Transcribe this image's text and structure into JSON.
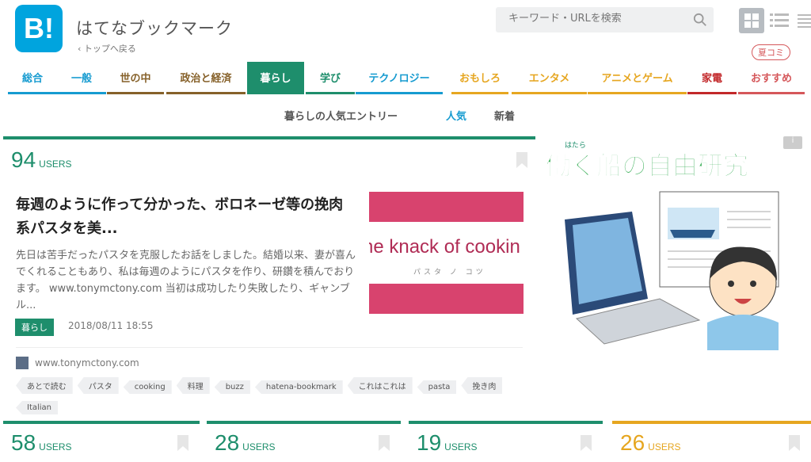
{
  "header": {
    "logo_text": "B!",
    "site_title": "はてなブックマーク",
    "back_link": "‹ トップへ戻る",
    "search_placeholder": "キーワード・URLを検索",
    "natsu_badge": "夏コミ"
  },
  "nav": {
    "items": [
      {
        "label": "総合",
        "color": "#169bd0"
      },
      {
        "label": "一般",
        "color": "#169bd0"
      },
      {
        "label": "世の中",
        "color": "#86612a"
      },
      {
        "label": "政治と経済",
        "color": "#86612a"
      },
      {
        "label": "暮らし",
        "color": "#1e8e6c",
        "active": true
      },
      {
        "label": "学び",
        "color": "#1e8e6c"
      },
      {
        "label": "テクノロジー",
        "color": "#169bd0"
      },
      {
        "label": "おもしろ",
        "color": "#e6a620"
      },
      {
        "label": "エンタメ",
        "color": "#e6a620"
      },
      {
        "label": "アニメとゲーム",
        "color": "#e6a620"
      },
      {
        "label": "家電",
        "color": "#c2282a"
      },
      {
        "label": "おすすめ",
        "color": "#d5575a"
      }
    ]
  },
  "sub_nav": {
    "title": "暮らしの人気エントリー",
    "popular": "人気",
    "new": "新着"
  },
  "main_entry": {
    "users_count": "94",
    "users_label": "USERS",
    "title": "毎週のように作って分かった、ボロネーゼ等の挽肉系パスタを美...",
    "description": "先日は苦手だったパスタを克服したお話をしました。結婚以来、妻が喜んでくれることもあり、私は毎週のようにパスタを作り、研鑽を積んでおります。 www.tonymctony.com 当初は成功したり失敗したり、ギャンブル...",
    "thumbnail_text": "he knack of cookin",
    "thumbnail_sub": "パスタ ノ コツ",
    "category": "暮らし",
    "date": "2018/08/11 18:55",
    "domain": "www.tonymctony.com",
    "tags": [
      "あとで読む",
      "パスタ",
      "cooking",
      "料理",
      "buzz",
      "hatena-bookmark",
      "これはこれは",
      "pasta",
      "挽き肉",
      "Italian"
    ]
  },
  "ad": {
    "info_label": "i",
    "ruby": "はたら",
    "headline": "働く船の自由研究"
  },
  "small_cards": [
    {
      "users_count": "58",
      "users_label": "USERS",
      "color": "#1e8e6c"
    },
    {
      "users_count": "28",
      "users_label": "USERS",
      "color": "#1e8e6c"
    },
    {
      "users_count": "19",
      "users_label": "USERS",
      "color": "#1e8e6c"
    },
    {
      "users_count": "26",
      "users_label": "USERS",
      "color": "#e6a620"
    }
  ]
}
